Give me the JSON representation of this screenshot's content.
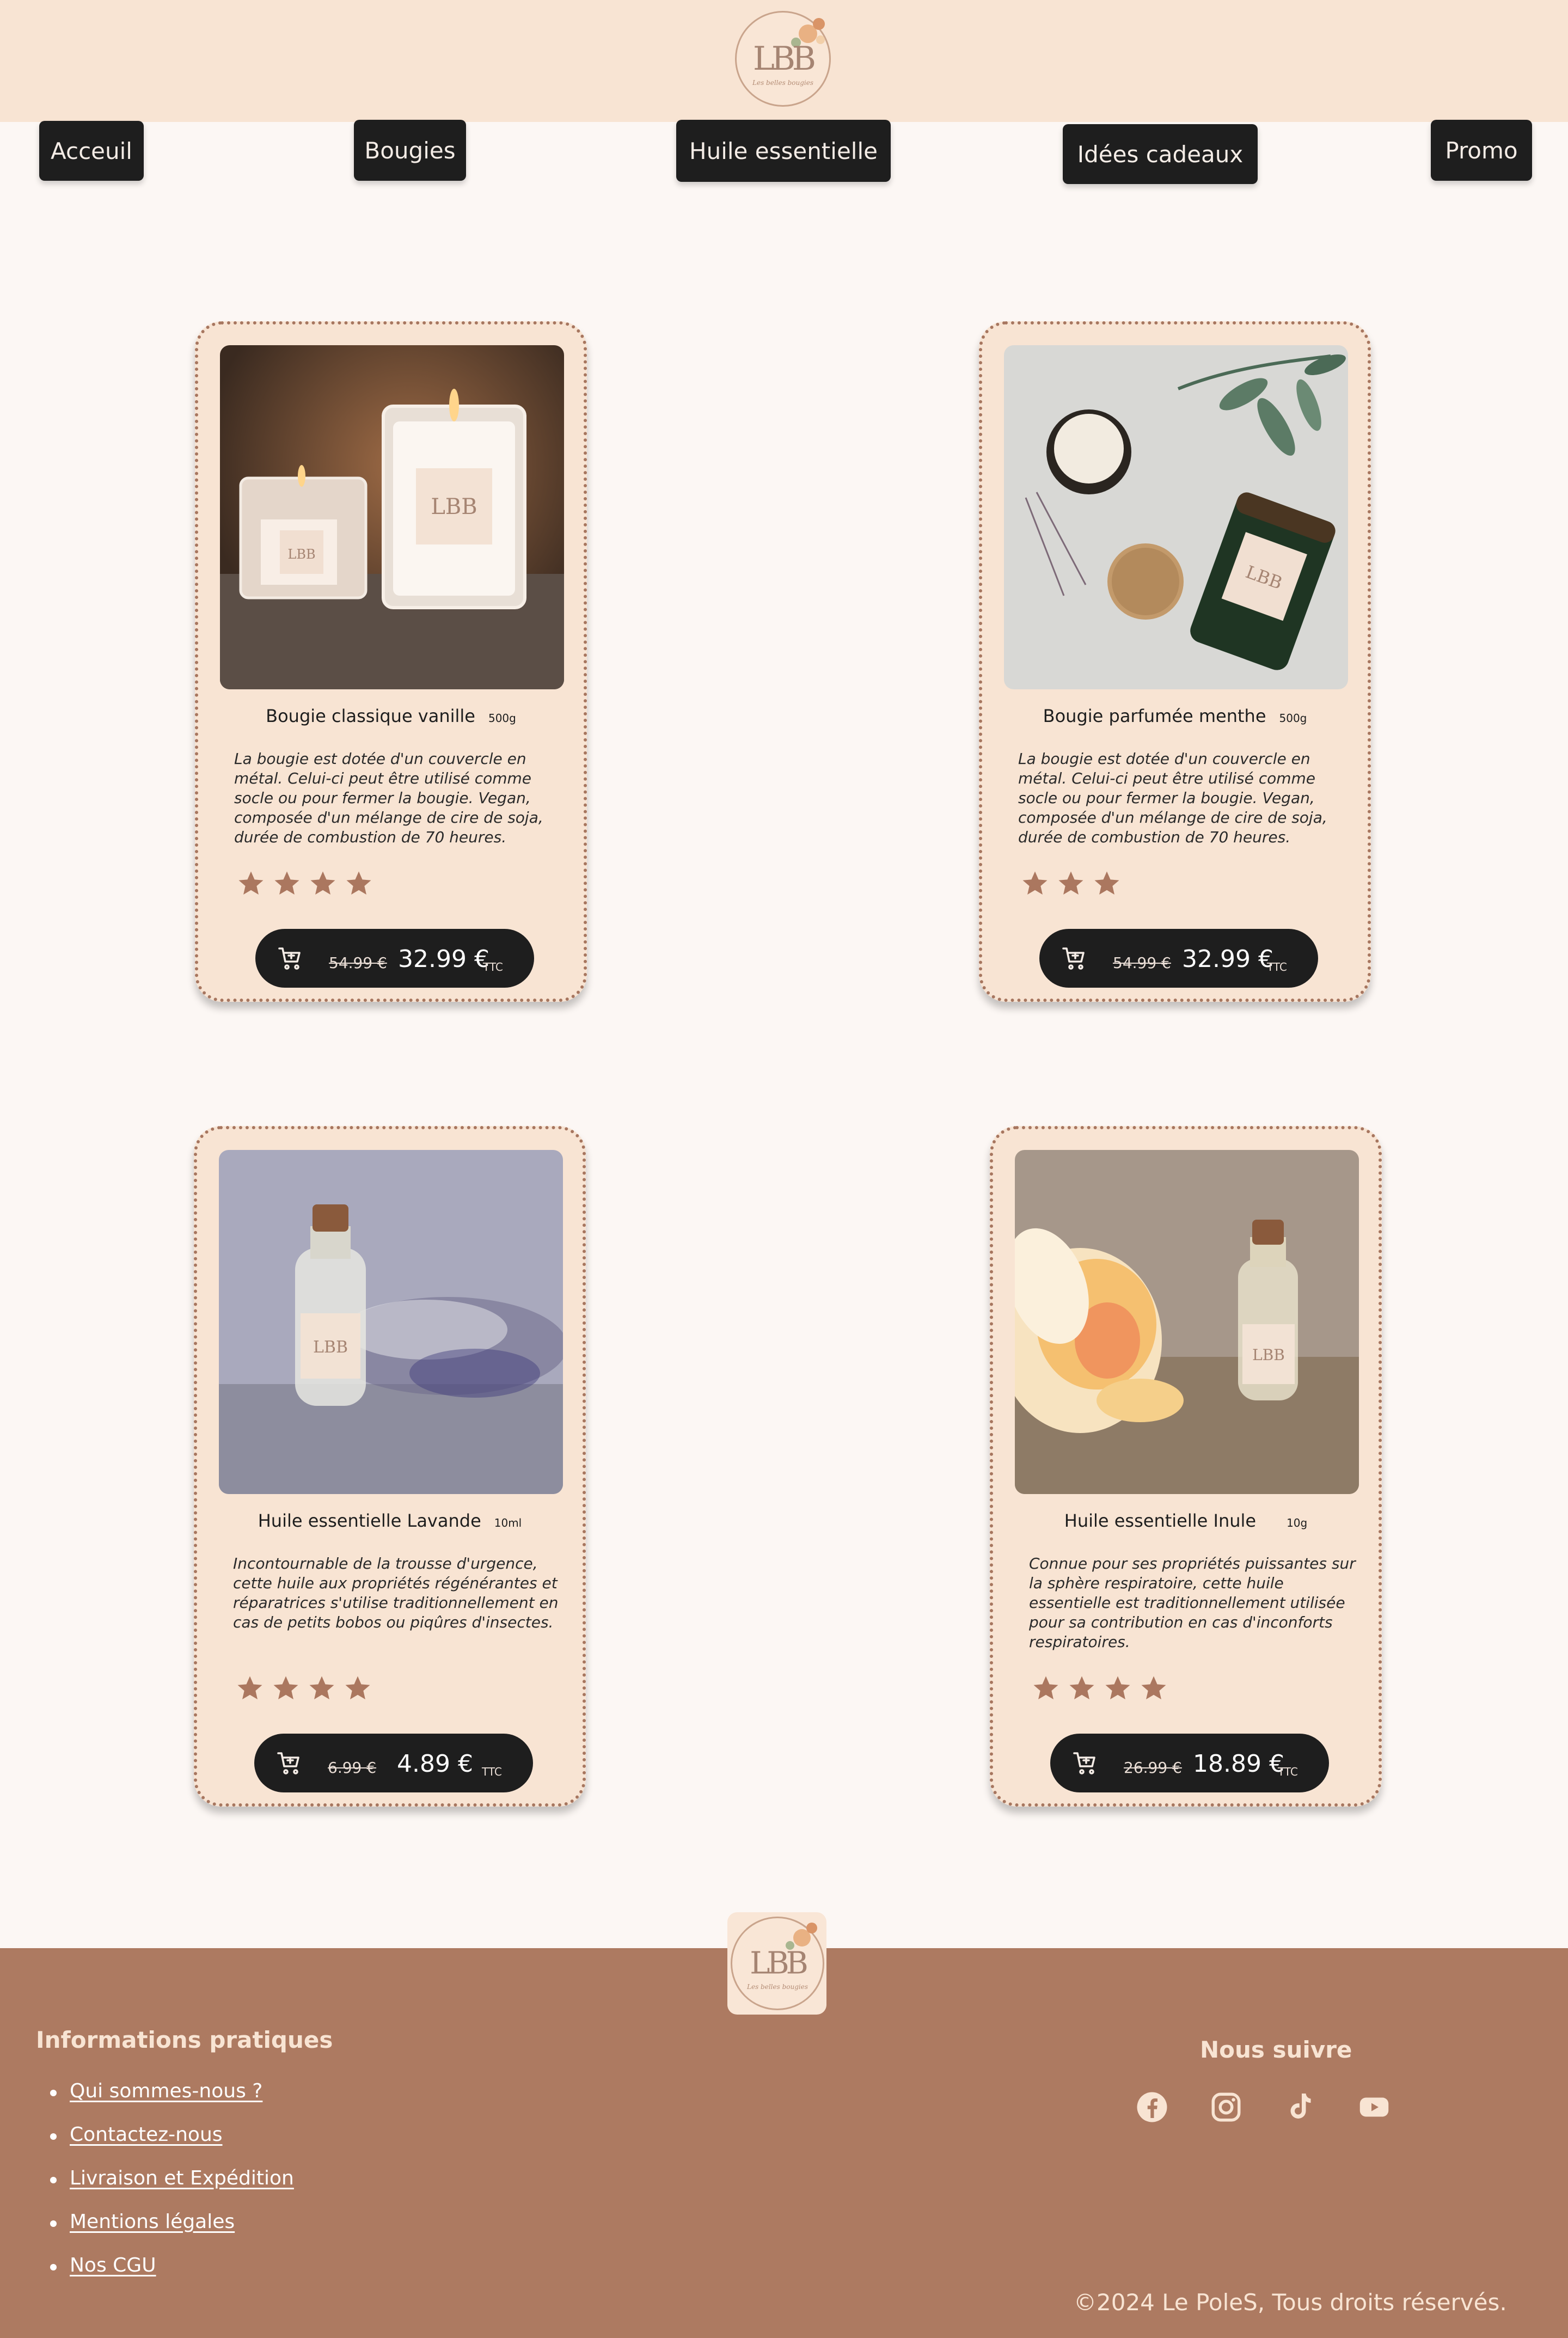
{
  "brand": {
    "logo_text": "LBB",
    "logo_tagline": "Les belles bougies"
  },
  "nav": {
    "items": [
      {
        "label": "Acceuil"
      },
      {
        "label": "Bougies"
      },
      {
        "label": "Huile essentielle"
      },
      {
        "label": "Idées cadeaux"
      },
      {
        "label": "Promo"
      }
    ]
  },
  "products": [
    {
      "name": "Bougie classique vanille",
      "unit": "500g",
      "description": "La bougie est dotée d'un couvercle en métal. Celui-ci peut être utilisé comme socle ou pour fermer la bougie. Vegan, composée d'un mélange de cire de soja, durée de combustion de 70 heures.",
      "rating": 4,
      "old_price": "54.99 €",
      "price": "32.99 €",
      "tax": "TTC"
    },
    {
      "name": "Bougie parfumée menthe",
      "unit": "500g",
      "description": "La bougie est dotée d'un couvercle en métal. Celui-ci peut être utilisé comme socle ou pour fermer la bougie. Vegan, composée d'un mélange de cire de soja, durée de combustion de 70 heures.",
      "rating": 3,
      "old_price": "54.99 €",
      "price": "32.99 €",
      "tax": "TTC"
    },
    {
      "name": "Huile essentielle Lavande",
      "unit": "10ml",
      "description": "Incontournable de la trousse d'urgence, cette huile aux propriétés régénérantes et réparatrices s'utilise traditionnellement en cas de petits bobos ou piqûres d'insectes.",
      "rating": 4,
      "old_price": "6.99 €",
      "price": "4.89 €",
      "tax": "TTC"
    },
    {
      "name": "Huile essentielle Inule",
      "unit": "10g",
      "description": "Connue pour ses propriétés puissantes sur la sphère respiratoire, cette huile essentielle est traditionnellement utilisée pour sa contribution en cas d'inconforts respiratoires.",
      "rating": 4,
      "old_price": "26.99 €",
      "price": "18.89 €",
      "tax": "TTC"
    }
  ],
  "footer": {
    "info_title": "Informations pratiques",
    "links": [
      {
        "label": "Qui sommes-nous ?"
      },
      {
        "label": "Contactez-nous"
      },
      {
        "label": "Livraison et Expédition"
      },
      {
        "label": "Mentions légales"
      },
      {
        "label": "Nos CGU"
      }
    ],
    "follow_title": "Nous suivre",
    "social_icons": [
      "facebook-icon",
      "instagram-icon",
      "tiktok-icon",
      "youtube-icon"
    ],
    "copyright": "©2024 Le PoleS, Tous droits réservés."
  },
  "colors": {
    "header_bg": "#f8e4d3",
    "page_bg": "#fcf7f4",
    "button_bg": "#1e1e1e",
    "accent_brown": "#ad7a61"
  }
}
